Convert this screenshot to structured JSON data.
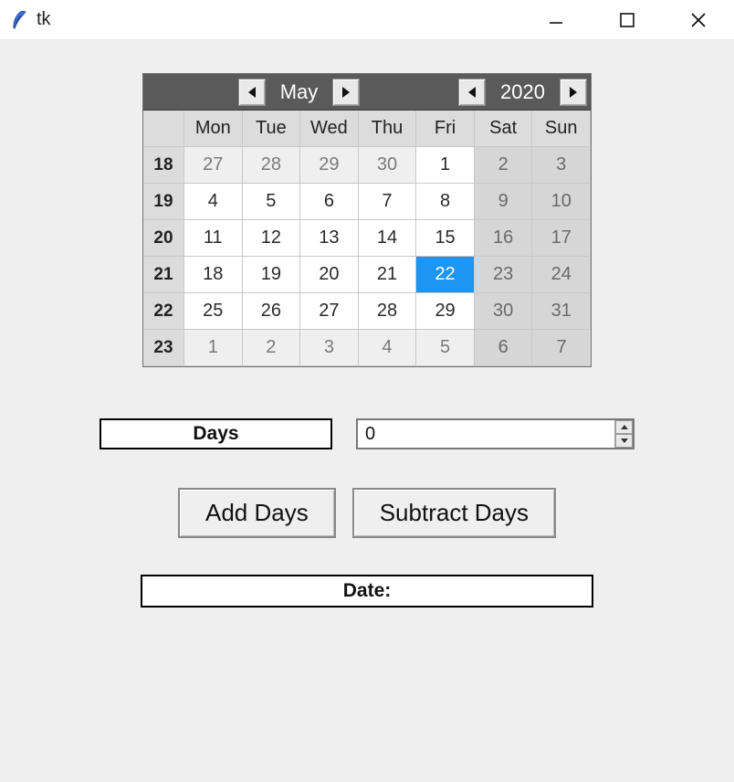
{
  "window": {
    "title": "tk"
  },
  "calendar": {
    "month_label": "May",
    "year_label": "2020",
    "day_headers": [
      "Mon",
      "Tue",
      "Wed",
      "Thu",
      "Fri",
      "Sat",
      "Sun"
    ],
    "weeks": [
      {
        "wk": "18",
        "days": [
          {
            "d": "27",
            "kind": "out"
          },
          {
            "d": "28",
            "kind": "out"
          },
          {
            "d": "29",
            "kind": "out"
          },
          {
            "d": "30",
            "kind": "out"
          },
          {
            "d": "1",
            "kind": "in"
          },
          {
            "d": "2",
            "kind": "wkend"
          },
          {
            "d": "3",
            "kind": "wkend"
          }
        ]
      },
      {
        "wk": "19",
        "days": [
          {
            "d": "4",
            "kind": "in"
          },
          {
            "d": "5",
            "kind": "in"
          },
          {
            "d": "6",
            "kind": "in"
          },
          {
            "d": "7",
            "kind": "in"
          },
          {
            "d": "8",
            "kind": "in"
          },
          {
            "d": "9",
            "kind": "wkend"
          },
          {
            "d": "10",
            "kind": "wkend"
          }
        ]
      },
      {
        "wk": "20",
        "days": [
          {
            "d": "11",
            "kind": "in"
          },
          {
            "d": "12",
            "kind": "in"
          },
          {
            "d": "13",
            "kind": "in"
          },
          {
            "d": "14",
            "kind": "in"
          },
          {
            "d": "15",
            "kind": "in"
          },
          {
            "d": "16",
            "kind": "wkend"
          },
          {
            "d": "17",
            "kind": "wkend"
          }
        ]
      },
      {
        "wk": "21",
        "days": [
          {
            "d": "18",
            "kind": "in"
          },
          {
            "d": "19",
            "kind": "in"
          },
          {
            "d": "20",
            "kind": "in"
          },
          {
            "d": "21",
            "kind": "in"
          },
          {
            "d": "22",
            "kind": "sel"
          },
          {
            "d": "23",
            "kind": "wkend"
          },
          {
            "d": "24",
            "kind": "wkend"
          }
        ]
      },
      {
        "wk": "22",
        "days": [
          {
            "d": "25",
            "kind": "in"
          },
          {
            "d": "26",
            "kind": "in"
          },
          {
            "d": "27",
            "kind": "in"
          },
          {
            "d": "28",
            "kind": "in"
          },
          {
            "d": "29",
            "kind": "in"
          },
          {
            "d": "30",
            "kind": "wkend"
          },
          {
            "d": "31",
            "kind": "wkend"
          }
        ]
      },
      {
        "wk": "23",
        "days": [
          {
            "d": "1",
            "kind": "out"
          },
          {
            "d": "2",
            "kind": "out"
          },
          {
            "d": "3",
            "kind": "out"
          },
          {
            "d": "4",
            "kind": "out"
          },
          {
            "d": "5",
            "kind": "out"
          },
          {
            "d": "6",
            "kind": "wkend"
          },
          {
            "d": "7",
            "kind": "wkend"
          }
        ]
      }
    ]
  },
  "days_box": {
    "label": "Days"
  },
  "spin": {
    "value": "0"
  },
  "buttons": {
    "add": "Add Days",
    "subtract": "Subtract Days"
  },
  "date_output": {
    "label": "Date:"
  }
}
